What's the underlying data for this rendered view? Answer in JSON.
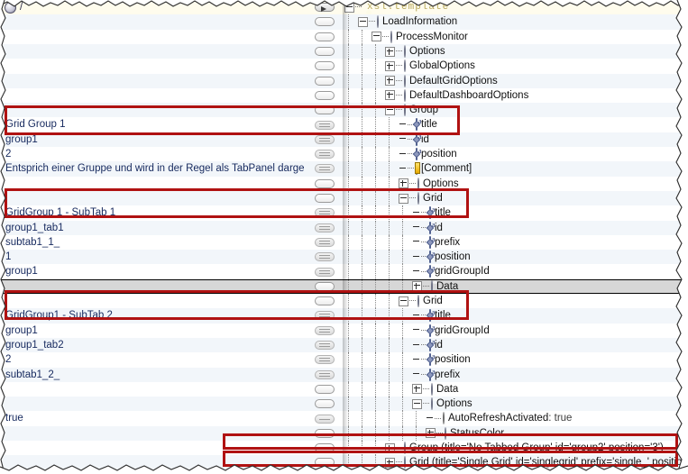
{
  "window": {
    "type": "xml-tree-editor",
    "root_path": "/",
    "accent_red": "#b01212",
    "highlight_row_bg": "#fffced",
    "selected_row_bg": "#d7d7d7",
    "alt_row_bg": "#f2f6fa"
  },
  "columns": {
    "value_header": "",
    "button_header": "",
    "tree_header": ""
  },
  "rows": [
    {
      "value": "",
      "button": "arrow",
      "indent": 0,
      "exp": "minus",
      "icon": "xsl-template-icon",
      "label": "xsl:template",
      "style": "xsl",
      "rowstyle": "hl"
    },
    {
      "value": "",
      "button": "empty",
      "indent": 1,
      "exp": "minus",
      "icon": "element-icon",
      "label": "LoadInformation",
      "style": "",
      "rowstyle": "alt"
    },
    {
      "value": "",
      "button": "empty",
      "indent": 2,
      "exp": "minus",
      "icon": "element-icon",
      "label": "ProcessMonitor",
      "style": "",
      "rowstyle": "plain"
    },
    {
      "value": "",
      "button": "empty",
      "indent": 3,
      "exp": "plus",
      "icon": "element-icon",
      "label": "Options",
      "style": "",
      "rowstyle": "alt"
    },
    {
      "value": "",
      "button": "empty",
      "indent": 3,
      "exp": "plus",
      "icon": "element-icon",
      "label": "GlobalOptions",
      "style": "",
      "rowstyle": "plain"
    },
    {
      "value": "",
      "button": "empty",
      "indent": 3,
      "exp": "plus",
      "icon": "element-icon",
      "label": "DefaultGridOptions",
      "style": "",
      "rowstyle": "alt"
    },
    {
      "value": "",
      "button": "empty",
      "indent": 3,
      "exp": "plus",
      "icon": "element-icon",
      "label": "DefaultDashboardOptions",
      "style": "",
      "rowstyle": "plain"
    },
    {
      "value": "",
      "button": "empty",
      "indent": 3,
      "exp": "minus",
      "icon": "element-icon",
      "label": "Group",
      "style": "",
      "rowstyle": "alt"
    },
    {
      "value": "Grid Group 1",
      "button": "lines",
      "indent": 4,
      "exp": "none",
      "icon": "attribute-icon",
      "label": "title",
      "style": "",
      "rowstyle": "plain"
    },
    {
      "value": "group1",
      "button": "lines",
      "indent": 4,
      "exp": "none",
      "icon": "attribute-icon",
      "label": "id",
      "style": "",
      "rowstyle": "alt"
    },
    {
      "value": "2",
      "button": "lines",
      "indent": 4,
      "exp": "none",
      "icon": "attribute-icon",
      "label": "position",
      "style": "",
      "rowstyle": "plain"
    },
    {
      "value": "Entsprich einer Gruppe und wird in der Regel als TabPanel dargestellt.",
      "button": "lines",
      "indent": 4,
      "exp": "none",
      "icon": "comment-icon",
      "label": "[Comment]",
      "style": "",
      "rowstyle": "alt"
    },
    {
      "value": "",
      "button": "empty",
      "indent": 4,
      "exp": "plus",
      "icon": "element-icon",
      "label": "Options",
      "style": "",
      "rowstyle": "plain"
    },
    {
      "value": "",
      "button": "empty",
      "indent": 4,
      "exp": "minus",
      "icon": "element-icon",
      "label": "Grid",
      "style": "",
      "rowstyle": "alt"
    },
    {
      "value": "GridGroup 1 - SubTab 1",
      "button": "lines",
      "indent": 5,
      "exp": "none",
      "icon": "attribute-icon",
      "label": "title",
      "style": "",
      "rowstyle": "plain"
    },
    {
      "value": "group1_tab1",
      "button": "lines",
      "indent": 5,
      "exp": "none",
      "icon": "attribute-icon",
      "label": "id",
      "style": "",
      "rowstyle": "alt"
    },
    {
      "value": "subtab1_1_",
      "button": "lines",
      "indent": 5,
      "exp": "none",
      "icon": "attribute-icon",
      "label": "prefix",
      "style": "",
      "rowstyle": "plain"
    },
    {
      "value": "1",
      "button": "lines",
      "indent": 5,
      "exp": "none",
      "icon": "attribute-icon",
      "label": "position",
      "style": "",
      "rowstyle": "alt"
    },
    {
      "value": "group1",
      "button": "lines",
      "indent": 5,
      "exp": "none",
      "icon": "attribute-icon",
      "label": "gridGroupId",
      "style": "",
      "rowstyle": "plain"
    },
    {
      "value": "",
      "button": "empty",
      "indent": 5,
      "exp": "plus",
      "icon": "element-icon",
      "label": "Data",
      "style": "",
      "rowstyle": "sel"
    },
    {
      "value": "",
      "button": "empty",
      "indent": 4,
      "exp": "minus",
      "icon": "element-icon",
      "label": "Grid",
      "style": "",
      "rowstyle": "plain"
    },
    {
      "value": "GridGroup1 - SubTab 2",
      "button": "lines",
      "indent": 5,
      "exp": "none",
      "icon": "attribute-icon",
      "label": "title",
      "style": "",
      "rowstyle": "alt"
    },
    {
      "value": "group1",
      "button": "lines",
      "indent": 5,
      "exp": "none",
      "icon": "attribute-icon",
      "label": "gridGroupId",
      "style": "",
      "rowstyle": "plain"
    },
    {
      "value": "group1_tab2",
      "button": "lines",
      "indent": 5,
      "exp": "none",
      "icon": "attribute-icon",
      "label": "id",
      "style": "",
      "rowstyle": "alt"
    },
    {
      "value": "2",
      "button": "lines",
      "indent": 5,
      "exp": "none",
      "icon": "attribute-icon",
      "label": "position",
      "style": "",
      "rowstyle": "plain"
    },
    {
      "value": "subtab1_2_",
      "button": "lines",
      "indent": 5,
      "exp": "none",
      "icon": "attribute-icon",
      "label": "prefix",
      "style": "",
      "rowstyle": "alt"
    },
    {
      "value": "",
      "button": "empty",
      "indent": 5,
      "exp": "plus",
      "icon": "element-icon",
      "label": "Data",
      "style": "",
      "rowstyle": "plain"
    },
    {
      "value": "",
      "button": "empty",
      "indent": 5,
      "exp": "minus",
      "icon": "element-icon",
      "label": "Options",
      "style": "",
      "rowstyle": "alt"
    },
    {
      "value": "true",
      "button": "single",
      "indent": 6,
      "exp": "none",
      "icon": "text-node-icon",
      "label": "AutoRefreshActivated",
      "suffix": " : true",
      "style": "",
      "rowstyle": "plain"
    },
    {
      "value": "",
      "button": "empty",
      "indent": 6,
      "exp": "plus",
      "icon": "element-icon",
      "label": "StatusColor",
      "style": "",
      "rowstyle": "alt"
    },
    {
      "value": "",
      "button": "empty",
      "indent": 3,
      "exp": "plus",
      "icon": "element-icon",
      "label": "Group (title='No Tabbed Group' id='group2' position='3')",
      "style": "",
      "rowstyle": "plain"
    },
    {
      "value": "",
      "button": "empty",
      "indent": 3,
      "exp": "plus",
      "icon": "element-icon",
      "label": "Grid (title='Single Grid' id='singlegrid' prefix='single_' position",
      "style": "",
      "rowstyle": "alt"
    }
  ],
  "annotations": [
    {
      "name": "group-title-highlight",
      "label": "Group / title highlight"
    },
    {
      "name": "grid-subtab1-highlight",
      "label": "Grid SubTab 1 / title highlight"
    },
    {
      "name": "grid-subtab2-highlight",
      "label": "Grid SubTab 2 / title highlight"
    },
    {
      "name": "group2-row-highlight",
      "label": "No Tabbed Group row highlight"
    },
    {
      "name": "singlegrid-row-highlight",
      "label": "Single Grid row highlight"
    }
  ]
}
